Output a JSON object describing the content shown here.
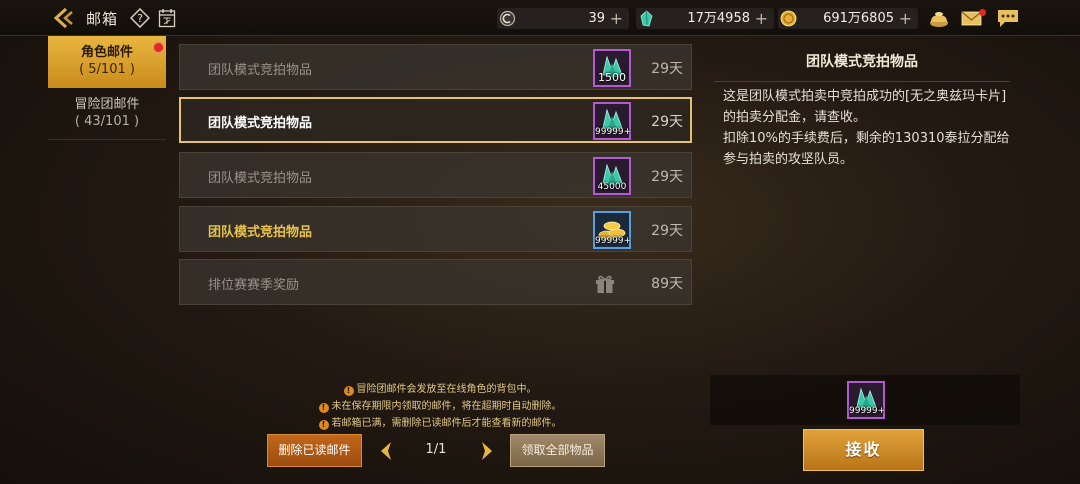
{
  "header": {
    "title": "邮箱",
    "currencies": [
      {
        "icon": "ticket-coin-icon",
        "value": "39"
      },
      {
        "icon": "crystal-icon",
        "value": "17万4958"
      },
      {
        "icon": "gold-coin-icon",
        "value": "691万6805"
      }
    ],
    "plus": "+"
  },
  "tabs": [
    {
      "label": "角色邮件",
      "count": "( 5/101 )",
      "active": true
    },
    {
      "label": "冒险团邮件",
      "count": "( 43/101 )",
      "active": false
    }
  ],
  "mails": [
    {
      "subject": "团队模式竞拍物品",
      "days": "29天",
      "item": "crystal",
      "qty": "1500",
      "state": "read"
    },
    {
      "subject": "团队模式竞拍物品",
      "days": "29天",
      "item": "crystal",
      "qty": "99999+",
      "state": "selected"
    },
    {
      "subject": "团队模式竞拍物品",
      "days": "29天",
      "item": "crystal",
      "qty": "45000",
      "state": "read"
    },
    {
      "subject": "团队模式竞拍物品",
      "days": "29天",
      "item": "gold",
      "qty": "99999+",
      "state": "unread"
    },
    {
      "subject": "排位赛赛季奖励",
      "days": "89天",
      "item": "gift",
      "qty": "",
      "state": "read"
    }
  ],
  "notices": [
    "冒险团邮件会发放至在线角色的背包中。",
    "未在保存期限内领取的邮件，将在超期时自动删除。",
    "若邮箱已满，需删除已读邮件后才能查看新的邮件。"
  ],
  "notice_mark": "!",
  "pager": {
    "delete_read": "删除已读邮件",
    "page": "1/1",
    "claim_all": "领取全部物品"
  },
  "detail": {
    "title": "团队模式竞拍物品",
    "body_line1": "这是团队模式拍卖中竞拍成功的[无之奥兹玛卡片]的拍卖分配金，请查收。",
    "body_line2": "扣除10%的手续费后，剩余的130310泰拉分配给参与拍卖的攻坚队员。",
    "attachment_qty": "99999+",
    "receive": "接收"
  },
  "colors": {
    "accent_gold": "#e8b640",
    "unread_text": "#e8c24a",
    "alert_red": "#e02a20"
  }
}
